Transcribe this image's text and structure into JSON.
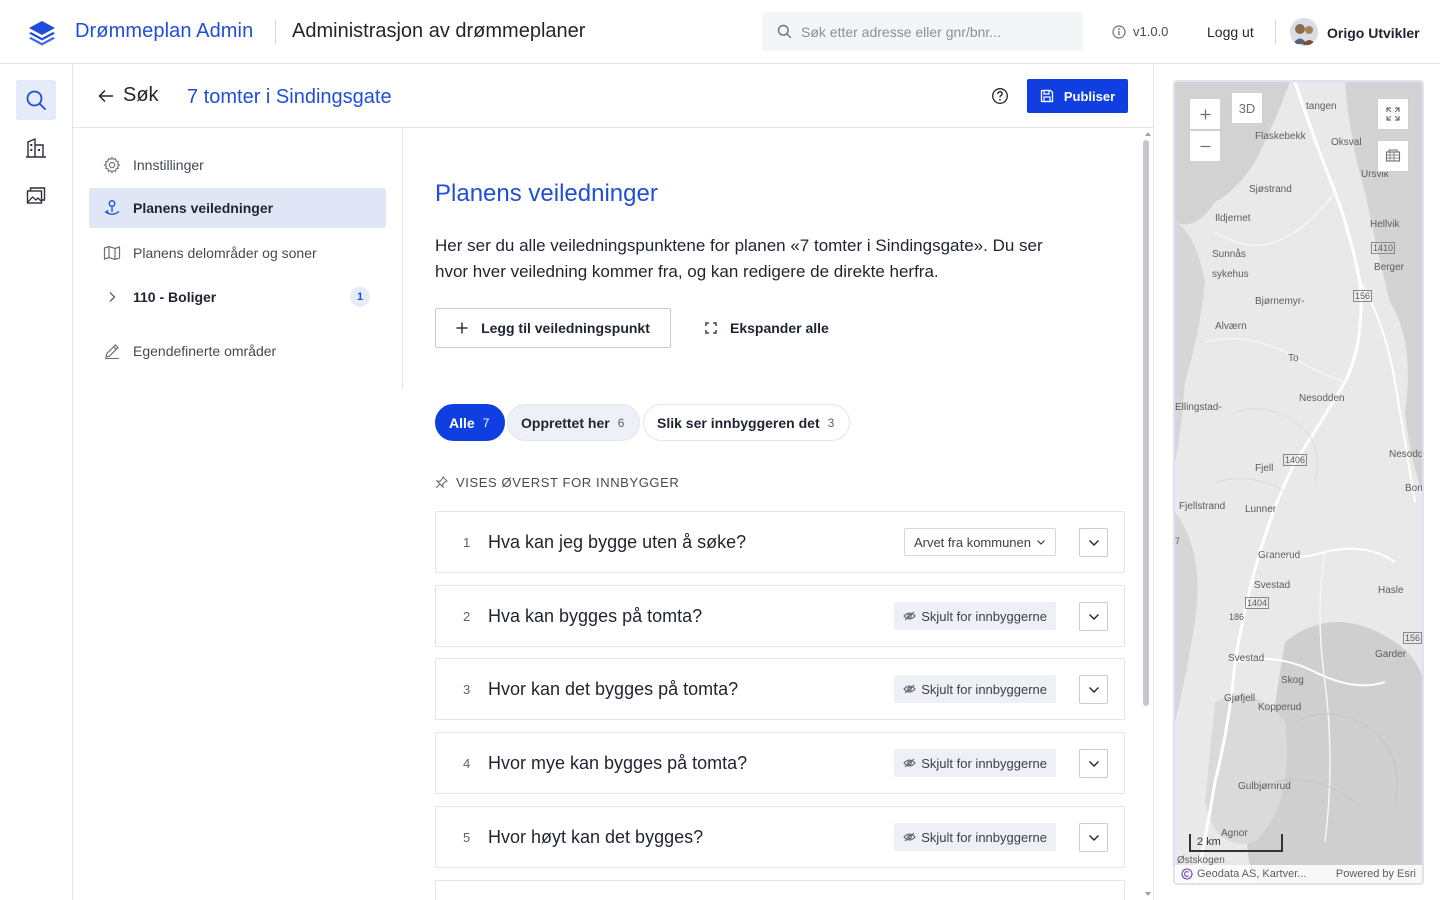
{
  "topbar": {
    "brand": "Drømmeplan Admin",
    "app_title": "Administrasjon av drømmeplaner",
    "search_placeholder": "Søk etter adresse eller gnr/bnr...",
    "version": "v1.0.0",
    "logout": "Logg ut",
    "username": "Origo Utvikler"
  },
  "header": {
    "back_label": "Søk",
    "plan_title": "7 tomter i Sindingsgate",
    "publish_label": "Publiser"
  },
  "subnav": {
    "items": [
      {
        "label": "Innstillinger",
        "icon": "gear-icon"
      },
      {
        "label": "Planens veiledninger",
        "icon": "guidance-icon",
        "active": true
      },
      {
        "label": "Planens delområder og soner",
        "icon": "map-icon"
      },
      {
        "label": "110 - Boliger",
        "icon": "chevron-right-icon",
        "badge": "1"
      },
      {
        "label": "Egendefinerte områder",
        "icon": "pencil-icon"
      }
    ]
  },
  "main": {
    "heading": "Planens veiledninger",
    "intro": "Her ser du alle veiledningspunktene for planen «7 tomter i Sindingsgate». Du ser hvor hver veiledning kommer fra, og kan redigere de direkte herfra.",
    "add_button": "Legg til veiledningspunkt",
    "expand_button": "Ekspander alle",
    "filters": [
      {
        "label": "Alle",
        "count": "7"
      },
      {
        "label": "Opprettet her",
        "count": "6"
      },
      {
        "label": "Slik ser innbyggeren det",
        "count": "3"
      }
    ],
    "pinned_label": "VISES ØVERST FOR INNBYGGER",
    "cards": [
      {
        "num": "1",
        "question": "Hva kan jeg bygge uten å søke?",
        "tag": "Arvet fra kommunen"
      },
      {
        "num": "2",
        "question": "Hva kan bygges på tomta?",
        "tag": "Skjult for innbyggerne"
      },
      {
        "num": "3",
        "question": "Hvor kan det bygges på tomta?",
        "tag": "Skjult for innbyggerne"
      },
      {
        "num": "4",
        "question": "Hvor mye kan bygges på tomta?",
        "tag": "Skjult for innbyggerne"
      },
      {
        "num": "5",
        "question": "Hvor høyt kan det bygges?",
        "tag": "Skjult for innbyggerne"
      }
    ]
  },
  "map": {
    "btn_3d": "3D",
    "scale_label": "2 km",
    "attribution": "Geodata AS, Kartver...",
    "powered_by": "Powered by Esri",
    "places": [
      "tangen",
      "Flaskebekk",
      "Oksval",
      "Ursvik",
      "Sjøstrand",
      "Ildjernet",
      "Hellvik",
      "1410",
      "Sunnås",
      "sykehus",
      "Berger",
      "156",
      "Bjørnemyr-",
      "Alværn",
      "To",
      "Nesodden",
      "Ellingstad-",
      "1406",
      "Nesodder",
      "Fjell",
      "Borr",
      "Fjellstrand",
      "Lunner",
      "7",
      "Granerud",
      "Svestad",
      "1404",
      "Hasle",
      "186",
      "156",
      "Svestad",
      "Garder",
      "Skog",
      "Gjøfjell",
      "Kopperud",
      "Gulbjørnrud",
      "Agnor",
      "Østskogen"
    ]
  }
}
